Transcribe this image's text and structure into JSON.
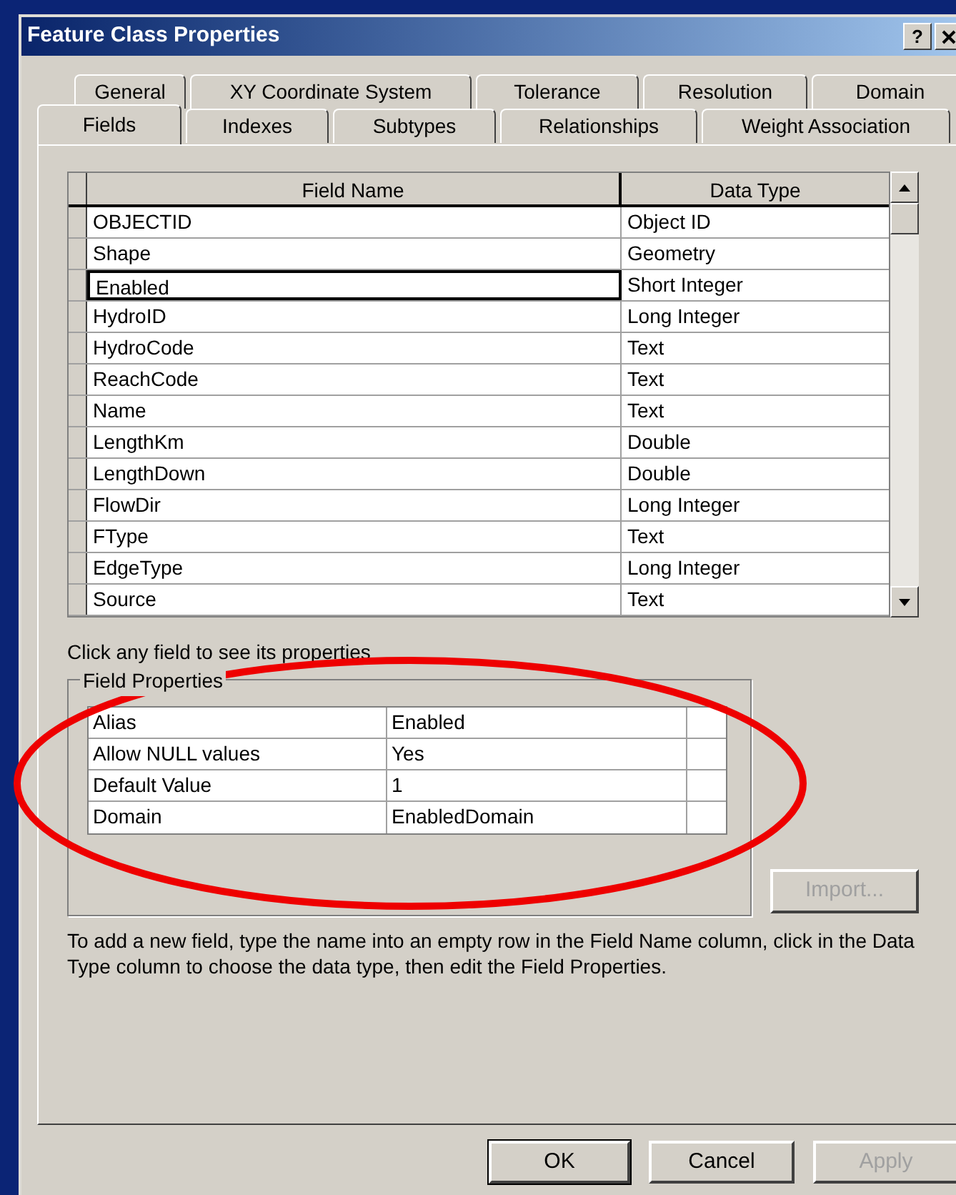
{
  "window": {
    "title": "Feature Class Properties",
    "help": "?"
  },
  "tab_rows": [
    [
      {
        "label": "General",
        "selected": false
      },
      {
        "label": "XY Coordinate System",
        "selected": false
      },
      {
        "label": "Tolerance",
        "selected": false
      },
      {
        "label": "Resolution",
        "selected": false
      },
      {
        "label": "Domain",
        "selected": false
      }
    ],
    [
      {
        "label": "Fields",
        "selected": true
      },
      {
        "label": "Indexes",
        "selected": false
      },
      {
        "label": "Subtypes",
        "selected": false
      },
      {
        "label": "Relationships",
        "selected": false
      },
      {
        "label": "Weight Association",
        "selected": false
      }
    ]
  ],
  "fields_table": {
    "columns": [
      "Field Name",
      "Data Type"
    ],
    "rows": [
      {
        "name": "OBJECTID",
        "type": "Object ID",
        "selected": false
      },
      {
        "name": "Shape",
        "type": "Geometry",
        "selected": false
      },
      {
        "name": "Enabled",
        "type": "Short Integer",
        "selected": true
      },
      {
        "name": "HydroID",
        "type": "Long Integer",
        "selected": false
      },
      {
        "name": "HydroCode",
        "type": "Text",
        "selected": false
      },
      {
        "name": "ReachCode",
        "type": "Text",
        "selected": false
      },
      {
        "name": "Name",
        "type": "Text",
        "selected": false
      },
      {
        "name": "LengthKm",
        "type": "Double",
        "selected": false
      },
      {
        "name": "LengthDown",
        "type": "Double",
        "selected": false
      },
      {
        "name": "FlowDir",
        "type": "Long Integer",
        "selected": false
      },
      {
        "name": "FType",
        "type": "Text",
        "selected": false
      },
      {
        "name": "EdgeType",
        "type": "Long Integer",
        "selected": false
      },
      {
        "name": "Source",
        "type": "Text",
        "selected": false
      }
    ]
  },
  "hint": "Click any field to see its properties",
  "field_properties": {
    "title": "Field Properties",
    "rows": [
      {
        "property": "Alias",
        "value": "Enabled"
      },
      {
        "property": "Allow NULL values",
        "value": "Yes"
      },
      {
        "property": "Default Value",
        "value": "1"
      },
      {
        "property": "Domain",
        "value": "EnabledDomain"
      }
    ]
  },
  "import_button": {
    "label": "Import...",
    "disabled": true
  },
  "instructions": "To add a new field, type the name into an empty row in the Field Name column, click in the Data Type column to choose the data type, then edit the Field Properties.",
  "buttons": [
    {
      "label": "OK",
      "default": true,
      "disabled": false
    },
    {
      "label": "Cancel",
      "default": false,
      "disabled": false
    },
    {
      "label": "Apply",
      "default": false,
      "disabled": true
    }
  ]
}
